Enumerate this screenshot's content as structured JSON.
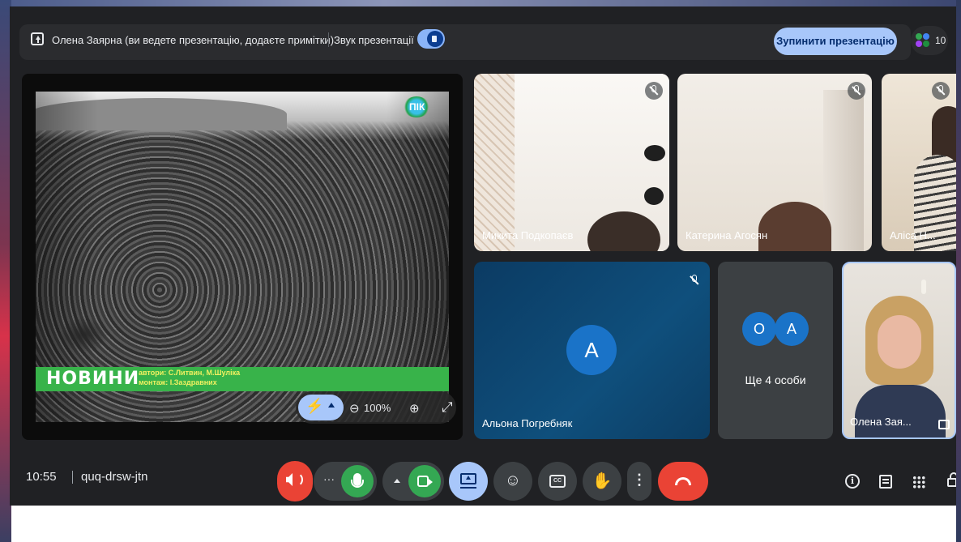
{
  "colors": {
    "background": "#202124",
    "accent_blue": "#a8c7fa",
    "end_call_red": "#ea4335",
    "mic_green": "#34a853",
    "avatar_blue": "#1a73c8"
  },
  "banner": {
    "presenter_text": "Олена Заярна (ви ведете презентацію, додаєте примітки)",
    "audio_label": "Звук презентації",
    "audio_enabled": true,
    "stop_button": "Зупинити презентацію",
    "people_count": "10"
  },
  "presentation": {
    "tv_logo": "ПІК",
    "news_title": "НОВИНИ",
    "credit_authors": "автори: С.Литвин, М.Шуліка",
    "credit_montage": "монтаж: І.Заздравних",
    "zoom_level": "100%",
    "icons": [
      "bolt-icon",
      "zoom-out-icon",
      "zoom-in-icon",
      "fullscreen-icon"
    ]
  },
  "participants": [
    {
      "name": "Микита Подкопаєв",
      "muted": true
    },
    {
      "name": "Катерина Агосян",
      "muted": true
    },
    {
      "name": "Аліса Н...",
      "muted": true
    },
    {
      "name": "Альона Погребняк",
      "initial": "A",
      "muted": true
    },
    {
      "name": "Олена Зая...",
      "self": true
    }
  ],
  "overflow": {
    "avatars": [
      "O",
      "A"
    ],
    "label": "Ще 4 особи"
  },
  "bottom": {
    "time": "10:55",
    "meeting_code": "quq-drsw-jtn",
    "controls": [
      "volume-icon",
      "more-options-icon",
      "mic-icon",
      "camera-icon",
      "present-icon",
      "emoji-icon",
      "captions-icon",
      "raise-hand-icon",
      "more-vert-icon",
      "end-call-icon"
    ],
    "right_icons": [
      "info-icon",
      "chat-icon",
      "activities-icon",
      "host-controls-icon"
    ]
  }
}
